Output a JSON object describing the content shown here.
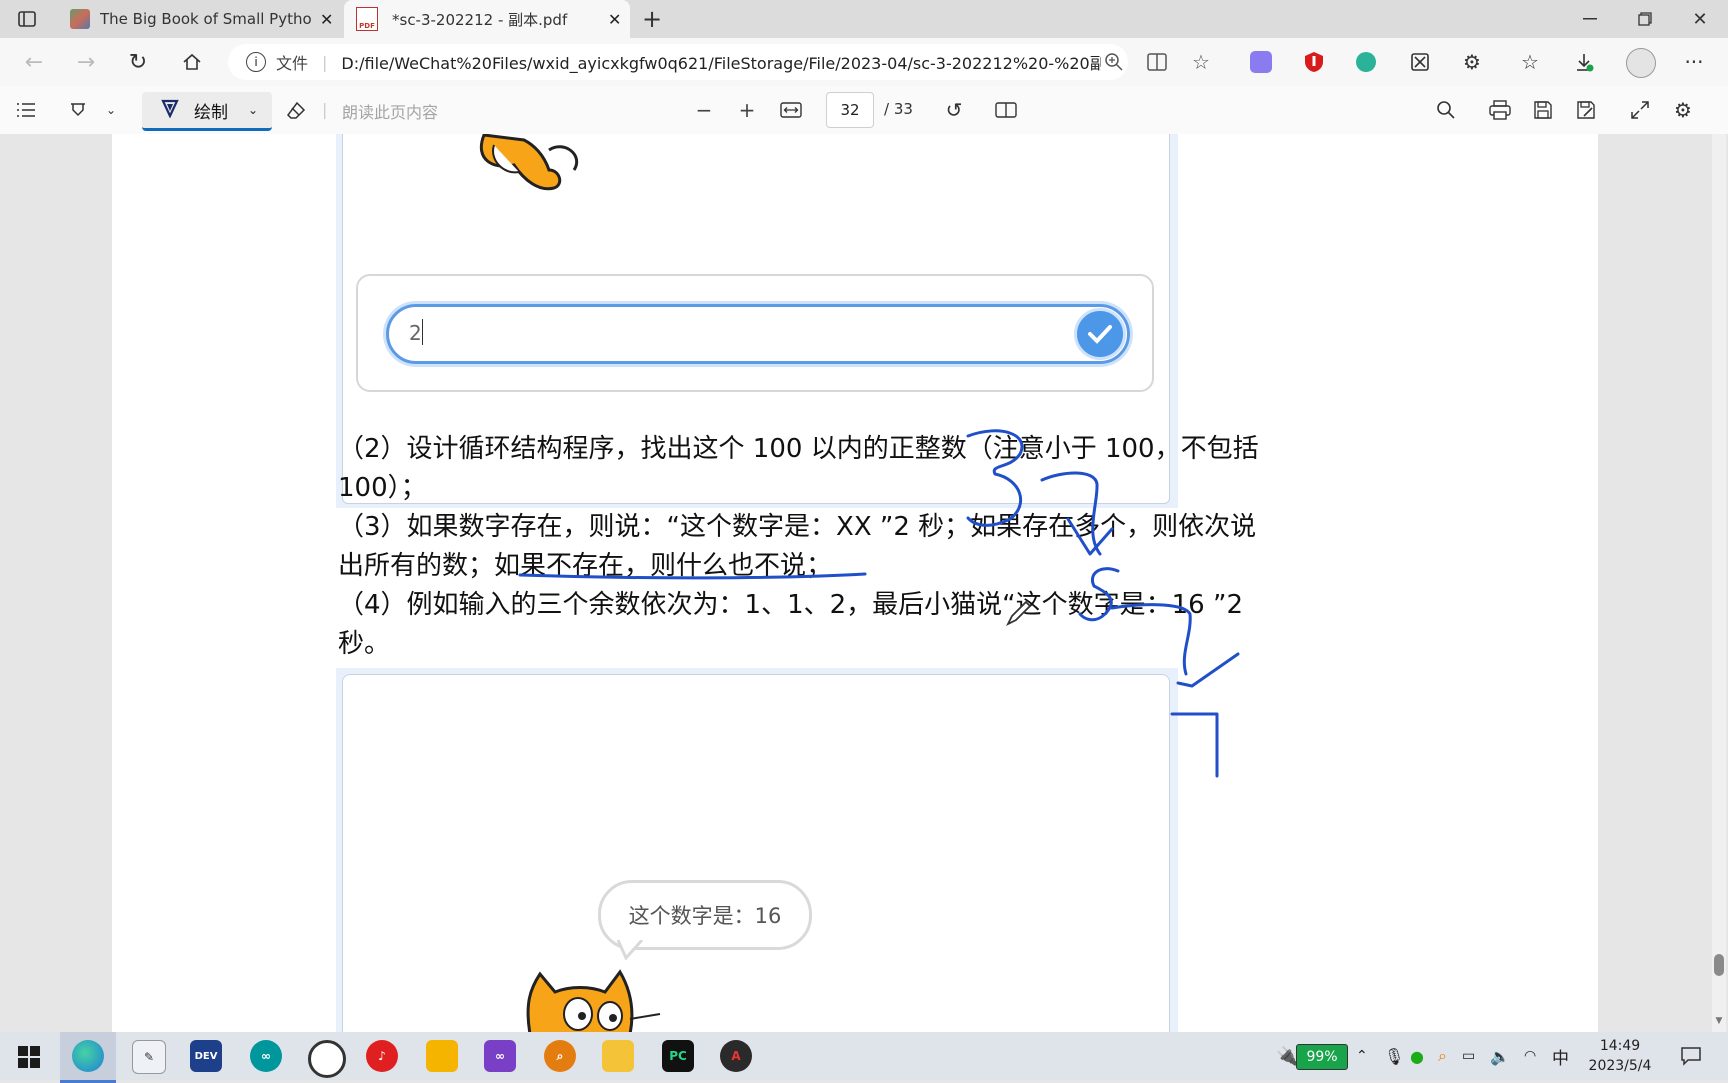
{
  "tabs": [
    {
      "title": "The Big Book of Small Python Pro",
      "active": false
    },
    {
      "title": "*sc-3-202212 - 副本.pdf",
      "active": true
    }
  ],
  "address": {
    "info_label": "文件",
    "url": "D:/file/WeChat%20Files/wxid_ayicxkgfw0q621/FileStorage/File/2023-04/sc-3-202212%20-%20副本...."
  },
  "pdf_toolbar": {
    "draw_label": "绘制",
    "read_aloud_label": "朗读此页内容",
    "current_page": "32",
    "total_pages": "/ 33"
  },
  "document": {
    "input_value": "2",
    "line1": "（2）设计循环结构程序，找出这个 100 以内的正整数（注意小于 100，不包括",
    "line2": "100）；",
    "line3": "（3）如果数字存在，则说：“这个数字是：XX ”2 秒；如果存在多个，则依次说",
    "line4a": "出所有的数；",
    "line4b": "如果不存在，则什么也不说",
    "line4c": "；",
    "line5": "（4）例如输入的三个余数依次为：1、1、2，最后小猫说“这个数字是：16 ”2",
    "line6": "秒。",
    "speech_bubble": "这个数字是：16"
  },
  "taskbar": {
    "battery": "99%",
    "ime": "中",
    "time": "14:49",
    "date": "2023/5/4"
  },
  "colors": {
    "ink": "#1f4fc9",
    "accent": "#0f6cbd",
    "battery": "#19a34a"
  }
}
